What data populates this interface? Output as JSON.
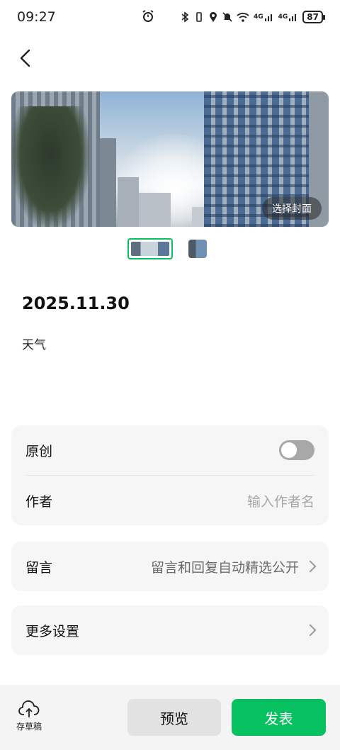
{
  "status_bar": {
    "time": "09:27",
    "network_1": "4G",
    "network_2": "4G",
    "battery": "87"
  },
  "cover": {
    "select_cover_label": "选择封面"
  },
  "article": {
    "title": "2025.11.30",
    "body": "天气"
  },
  "settings": {
    "original_label": "原创",
    "original_enabled": false,
    "author_label": "作者",
    "author_placeholder": "输入作者名",
    "comments_label": "留言",
    "comments_value": "留言和回复自动精选公开",
    "more_settings_label": "更多设置"
  },
  "bottom_bar": {
    "save_draft_label": "存草稿",
    "preview_label": "预览",
    "publish_label": "发表"
  },
  "colors": {
    "accent": "#07c160",
    "card_bg": "#f6f6f7"
  }
}
